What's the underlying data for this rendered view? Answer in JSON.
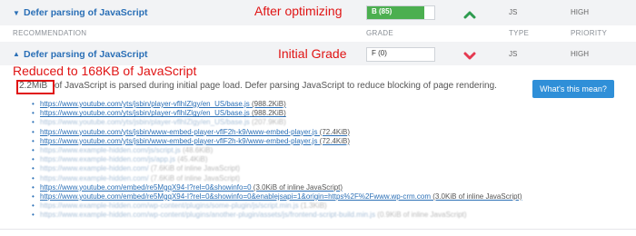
{
  "top_row": {
    "title": "Defer parsing of JavaScript",
    "annotation": "After optimizing",
    "grade": "B (85)",
    "grade_percent": 85,
    "type": "JS",
    "priority": "HIGH",
    "arrow": "up-arrow-icon",
    "colors": {
      "good": "#4caf50"
    }
  },
  "header": {
    "recommendation": "RECOMMENDATION",
    "grade": "GRADE",
    "type": "TYPE",
    "priority": "PRIORITY"
  },
  "second_row": {
    "title": "Defer parsing of JavaScript",
    "annotation": "Initial Grade",
    "grade": "F (0)",
    "type": "JS",
    "priority": "HIGH",
    "arrow": "down-arrow-icon",
    "colors": {
      "bad": "#e53950"
    }
  },
  "detail": {
    "annotation": "Reduced to 168KB of JavaScript",
    "size": "2.2MiB",
    "description": "of JavaScript is parsed during initial page load. Defer parsing JavaScript to reduce blocking of page rendering.",
    "button": "What's this mean?",
    "urls": [
      {
        "link": "https://www.youtube.com/yts/jsbin/player-vflhIZlgy/en_US/base.js",
        "note": "(988.2KiB)",
        "blurred": false
      },
      {
        "link": "https://www.youtube.com/yts/jsbin/player-vflhIZlgy/en_US/base.js",
        "note": "(988.2KiB)",
        "blurred": false
      },
      {
        "link": "https://www.youtube.com/yts/jsbin/player-vflhIZlgy/en_US/base.js",
        "note": "(207.9KiB)",
        "blurred": true
      },
      {
        "link": "https://www.youtube.com/yts/jsbin/www-embed-player-vflF2h-k9/www-embed-player.js",
        "note": "(72.4KiB)",
        "blurred": false
      },
      {
        "link": "https://www.youtube.com/yts/jsbin/www-embed-player-vflF2h-k9/www-embed-player.js",
        "note": "(72.4KiB)",
        "blurred": false
      },
      {
        "link": "https://www.example-hidden.com/js/script.js",
        "note": "(48.6KiB)",
        "blurred": true
      },
      {
        "link": "https://www.example-hidden.com/js/app.js",
        "note": "(45.4KiB)",
        "blurred": true
      },
      {
        "link": "https://www.example-hidden.com/",
        "note": "(7.6KiB of inline JavaScript)",
        "blurred": true
      },
      {
        "link": "https://www.example-hidden.com/",
        "note": "(7.6KiB of inline JavaScript)",
        "blurred": true
      },
      {
        "link": "https://www.youtube.com/embed/re5MgqX94-I?rel=0&showinfo=0",
        "note": "(3.0KiB of inline JavaScript)",
        "blurred": false
      },
      {
        "link": "https://www.youtube.com/embed/re5MgqX94-I?rel=0&showinfo=0&enablejsapi=1&origin=https%2F%2Fwww.wp-crm.com",
        "note": "(3.0KiB of inline JavaScript)",
        "blurred": false
      },
      {
        "link": "https://www.example-hidden.com/wp-content/plugins/some-plugin/js/script.min.js",
        "note": "(1.3KiB)",
        "blurred": true
      },
      {
        "link": "https://www.example-hidden.com/wp-content/plugins/another-plugin/assets/js/frontend-script-build.min.js",
        "note": "(0.9KiB of inline JavaScript)",
        "blurred": true
      }
    ]
  }
}
